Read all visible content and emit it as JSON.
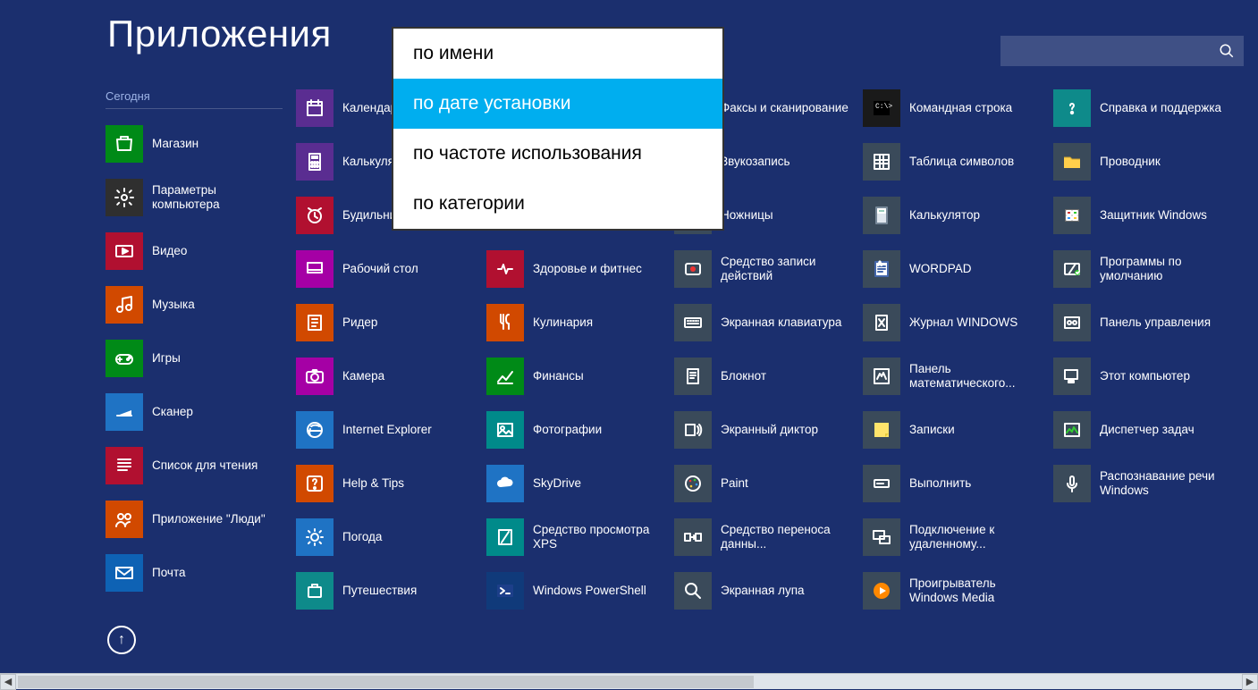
{
  "header": {
    "title": "Приложения",
    "group_today": "Сегодня"
  },
  "search": {
    "icon": "search-icon"
  },
  "dropdown": {
    "items": [
      {
        "label": "по имени"
      },
      {
        "label": "по дате установки"
      },
      {
        "label": "по частоте использования"
      },
      {
        "label": "по категории"
      }
    ],
    "selected_index": 1
  },
  "columns": [
    [
      {
        "label": "Магазин",
        "color": "#008a17",
        "icon": "store-icon"
      },
      {
        "label": "Параметры компьютера",
        "color": "#2f2f2f",
        "icon": "gear-icon",
        "two": true
      },
      {
        "label": "Видео",
        "color": "#b11030",
        "icon": "video-icon"
      },
      {
        "label": "Музыка",
        "color": "#d14900",
        "icon": "music-icon"
      },
      {
        "label": "Игры",
        "color": "#008a17",
        "icon": "games-icon"
      },
      {
        "label": "Сканер",
        "color": "#1f73c4",
        "icon": "scanner-icon"
      },
      {
        "label": "Список для чтения",
        "color": "#b11030",
        "icon": "reading-icon"
      },
      {
        "label": "Приложение \"Люди\"",
        "color": "#d14900",
        "icon": "people-icon",
        "two": true
      },
      {
        "label": "Почта",
        "color": "#0e62b4",
        "icon": "mail-icon"
      }
    ],
    [
      {
        "label": "Календарь",
        "color": "#5a2d91",
        "icon": "calendar-icon"
      },
      {
        "label": "Калькулятор",
        "color": "#5a2d91",
        "icon": "calculator-icon"
      },
      {
        "label": "Будильник",
        "color": "#b11030",
        "icon": "alarm-icon"
      },
      {
        "label": "Рабочий стол",
        "color": "#a500a5",
        "icon": "desktop-icon"
      },
      {
        "label": "Ридер",
        "color": "#d14900",
        "icon": "reader-icon"
      },
      {
        "label": "Камера",
        "color": "#a500a5",
        "icon": "camera-icon"
      },
      {
        "label": "Internet Explorer",
        "color": "#1f73c4",
        "icon": "ie-icon"
      },
      {
        "label": "Help & Tips",
        "color": "#d14900",
        "icon": "help-icon"
      },
      {
        "label": "Погода",
        "color": "#1f73c4",
        "icon": "weather-icon"
      },
      {
        "label": "Путешествия",
        "color": "#0e8a8a",
        "icon": "travel-icon"
      }
    ],
    [
      {
        "label": "Здоровье и фитнес",
        "color": "#b11030",
        "icon": "health-icon",
        "two": true
      },
      {
        "label": "Кулинария",
        "color": "#d14900",
        "icon": "food-icon"
      },
      {
        "label": "Финансы",
        "color": "#008a17",
        "icon": "finance-icon"
      },
      {
        "label": "Фотографии",
        "color": "#008a8a",
        "icon": "photos-icon"
      },
      {
        "label": "SkyDrive",
        "color": "#1f73c4",
        "icon": "skydrive-icon"
      },
      {
        "label": "Средство просмотра XPS",
        "color": "#008a8a",
        "icon": "xps-icon",
        "two": true
      },
      {
        "label": "Windows PowerShell",
        "color": "#103a7a",
        "icon": "powershell-icon",
        "two": true
      }
    ],
    [
      {
        "label": "Факсы и сканирование",
        "color": "#3a4a5a",
        "icon": "fax-icon",
        "two": true
      },
      {
        "label": "Звукозапись",
        "color": "#3a4a5a",
        "icon": "recorder-icon"
      },
      {
        "label": "Ножницы",
        "color": "#3a4a5a",
        "icon": "snip-icon"
      },
      {
        "label": "Средство записи действий",
        "color": "#3a4a5a",
        "icon": "steps-icon",
        "two": true
      },
      {
        "label": "Экранная клавиатура",
        "color": "#3a4a5a",
        "icon": "osk-icon",
        "two": true
      },
      {
        "label": "Блокнот",
        "color": "#3a4a5a",
        "icon": "notepad-icon"
      },
      {
        "label": "Экранный диктор",
        "color": "#3a4a5a",
        "icon": "narrator-icon"
      },
      {
        "label": "Paint",
        "color": "#3a4a5a",
        "icon": "paint-icon"
      },
      {
        "label": "Средство переноса данны...",
        "color": "#3a4a5a",
        "icon": "transfer-icon",
        "two": true
      },
      {
        "label": "Экранная лупа",
        "color": "#3a4a5a",
        "icon": "magnifier-icon"
      }
    ],
    [
      {
        "label": "Командная строка",
        "color": "#1a1a1a",
        "icon": "cmd-icon"
      },
      {
        "label": "Таблица символов",
        "color": "#3a4a5a",
        "icon": "charmap-icon"
      },
      {
        "label": "Калькулятор",
        "color": "#3a4a5a",
        "icon": "calc2-icon"
      },
      {
        "label": "WORDPAD",
        "color": "#3a4a5a",
        "icon": "wordpad-icon"
      },
      {
        "label": "Журнал WINDOWS",
        "color": "#3a4a5a",
        "icon": "journal-icon"
      },
      {
        "label": "Панель математического...",
        "color": "#3a4a5a",
        "icon": "math-icon",
        "two": true
      },
      {
        "label": "Записки",
        "color": "#3a4a5a",
        "icon": "sticky-icon"
      },
      {
        "label": "Выполнить",
        "color": "#3a4a5a",
        "icon": "run-icon"
      },
      {
        "label": "Подключение к удаленному...",
        "color": "#3a4a5a",
        "icon": "rdp-icon",
        "two": true
      },
      {
        "label": "Проигрыватель Windows Media",
        "color": "#3a4a5a",
        "icon": "wmp-icon",
        "two": true
      }
    ],
    [
      {
        "label": "Справка и поддержка",
        "color": "#0e8a8a",
        "icon": "support-icon",
        "two": true
      },
      {
        "label": "Проводник",
        "color": "#3a4a5a",
        "icon": "explorer-icon"
      },
      {
        "label": "Защитник Windows",
        "color": "#3a4a5a",
        "icon": "defender-icon",
        "two": true
      },
      {
        "label": "Программы по умолчанию",
        "color": "#3a4a5a",
        "icon": "defaults-icon",
        "two": true
      },
      {
        "label": "Панель управления",
        "color": "#3a4a5a",
        "icon": "cpanel-icon",
        "two": true
      },
      {
        "label": "Этот компьютер",
        "color": "#3a4a5a",
        "icon": "pc-icon"
      },
      {
        "label": "Диспетчер задач",
        "color": "#3a4a5a",
        "icon": "taskmgr-icon"
      },
      {
        "label": "Распознавание речи Windows",
        "color": "#3a4a5a",
        "icon": "speech-icon",
        "two": true
      }
    ]
  ],
  "col3_top_skip": 3,
  "column_offsets": [
    0,
    213,
    426,
    636,
    847,
    1060
  ]
}
